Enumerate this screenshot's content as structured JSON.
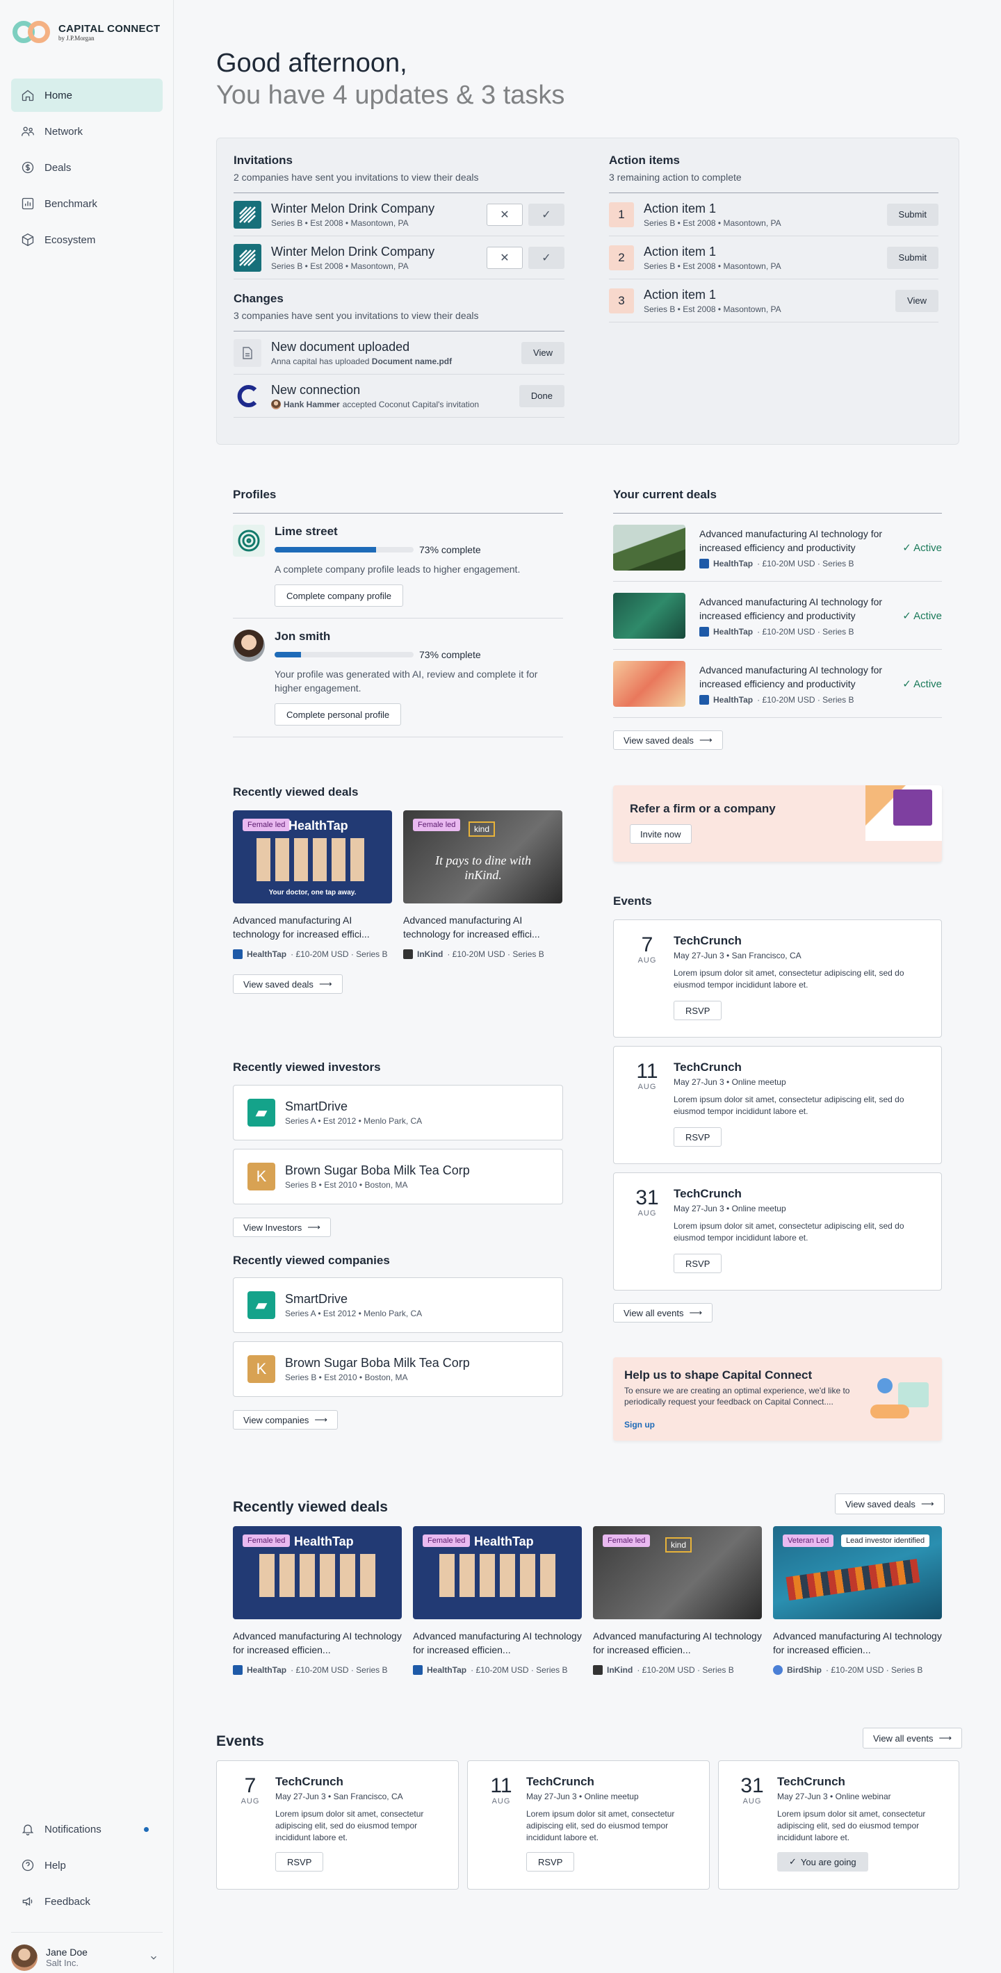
{
  "brand": {
    "title": "CAPITAL CONNECT",
    "sub": "by J.P.Morgan"
  },
  "nav": {
    "items": [
      {
        "label": "Home",
        "icon": "home-icon"
      },
      {
        "label": "Network",
        "icon": "network-icon"
      },
      {
        "label": "Deals",
        "icon": "dollar-icon"
      },
      {
        "label": "Benchmark",
        "icon": "chart-icon"
      },
      {
        "label": "Ecosystem",
        "icon": "cube-icon"
      }
    ],
    "bottom": [
      {
        "label": "Notifications",
        "icon": "bell-icon"
      },
      {
        "label": "Help",
        "icon": "help-icon"
      },
      {
        "label": "Feedback",
        "icon": "feedback-icon"
      }
    ]
  },
  "user": {
    "name": "Jane Doe",
    "org": "Salt Inc."
  },
  "greeting": {
    "line1": "Good afternoon,",
    "line2": "You have 4 updates & 3 tasks"
  },
  "invitations": {
    "title": "Invitations",
    "sub": "2 companies have sent you invitations to view their deals",
    "items": [
      {
        "name": "Winter Melon Drink Company",
        "meta": "Series B • Est 2008 • Masontown, PA"
      },
      {
        "name": "Winter Melon Drink Company",
        "meta": "Series B • Est 2008 • Masontown, PA"
      }
    ]
  },
  "changes": {
    "title": "Changes",
    "sub": "3 companies have sent you invitations to view their deals",
    "items": [
      {
        "title": "New document uploaded",
        "pre": "Anna capital has uploaded ",
        "bold": "Document name.pdf",
        "post": "",
        "button": "View"
      },
      {
        "title": "New connection",
        "pre": "",
        "bold": "Hank Hammer",
        "post": " accepted Coconut Capital's invitation",
        "button": "Done"
      }
    ]
  },
  "actions": {
    "title": "Action items",
    "sub": "3 remaining action to complete",
    "items": [
      {
        "num": "1",
        "title": "Action item 1",
        "meta": "Series B • Est 2008 • Masontown, PA",
        "button": "Submit"
      },
      {
        "num": "2",
        "title": "Action item 1",
        "meta": "Series B • Est 2008 • Masontown, PA",
        "button": "Submit"
      },
      {
        "num": "3",
        "title": "Action item 1",
        "meta": "Series B • Est 2008 • Masontown, PA",
        "button": "View"
      }
    ]
  },
  "profiles": {
    "title": "Profiles",
    "items": [
      {
        "name": "Lime street",
        "progress": 0.73,
        "progress_label": "73% complete",
        "desc": "A complete company profile leads to higher engagement.",
        "button": "Complete company profile"
      },
      {
        "name": "Jon smith",
        "progress": 0.19,
        "progress_label": "73% complete",
        "desc": "Your profile was generated with AI, review and complete it for higher engagement.",
        "button": "Complete personal profile"
      }
    ]
  },
  "current_deals": {
    "title": "Your current deals",
    "items": [
      {
        "desc": "Advanced manufacturing AI technology for increased efficiency and productivity",
        "company": "HealthTap",
        "meta": "· £10-20M USD · Series B",
        "status": "Active"
      },
      {
        "desc": "Advanced manufacturing AI technology for increased efficiency and productivity",
        "company": "HealthTap",
        "meta": "· £10-20M USD · Series B",
        "status": "Active"
      },
      {
        "desc": "Advanced manufacturing AI technology for increased efficiency and productivity",
        "company": "HealthTap",
        "meta": "· £10-20M USD · Series B",
        "status": "Active"
      }
    ],
    "button": "View saved deals"
  },
  "refer": {
    "title": "Refer a firm or a company",
    "button": "Invite now"
  },
  "rv_deals": {
    "title": "Recently viewed deals",
    "items": [
      {
        "tag": "Female led",
        "brand": "HealthTap",
        "tagline": "Your doctor, one tap away.",
        "desc": "Advanced manufacturing AI technology for increased effici...",
        "company": "HealthTap",
        "meta": "· £10-20M USD · Series B"
      },
      {
        "tag": "Female led",
        "brand": "kind",
        "tagline": "It pays to dine with inKind.",
        "desc": "Advanced manufacturing AI technology for increased effici...",
        "company": "InKind",
        "meta": "· £10-20M USD · Series B"
      }
    ],
    "button": "View saved deals"
  },
  "events_side": {
    "title": "Events",
    "items": [
      {
        "day": "7",
        "month": "AUG",
        "title": "TechCrunch",
        "meta": "May 27-Jun 3  •  San Francisco, CA",
        "desc": "Lorem ipsum dolor sit amet, consectetur adipiscing elit, sed do eiusmod tempor incididunt labore et.",
        "button": "RSVP"
      },
      {
        "day": "11",
        "month": "AUG",
        "title": "TechCrunch",
        "meta": "May 27-Jun 3  •  Online meetup",
        "desc": "Lorem ipsum dolor sit amet, consectetur adipiscing elit, sed do eiusmod tempor incididunt labore et.",
        "button": "RSVP"
      },
      {
        "day": "31",
        "month": "AUG",
        "title": "TechCrunch",
        "meta": "May 27-Jun 3  •  Online meetup",
        "desc": "Lorem ipsum dolor sit amet, consectetur adipiscing elit, sed do eiusmod tempor incididunt labore et.",
        "button": "RSVP"
      }
    ],
    "button": "View all events"
  },
  "rv_investors": {
    "title": "Recently viewed investors",
    "items": [
      {
        "name": "SmartDrive",
        "meta": "Series A • Est 2012 • Menlo Park, CA"
      },
      {
        "name": "Brown Sugar Boba Milk Tea Corp",
        "meta": "Series B • Est 2010 • Boston, MA"
      }
    ],
    "button": "View Investors"
  },
  "rv_companies": {
    "title": "Recently viewed companies",
    "items": [
      {
        "name": "SmartDrive",
        "meta": "Series A • Est 2012 • Menlo Park, CA"
      },
      {
        "name": "Brown Sugar Boba Milk Tea Corp",
        "meta": "Series B • Est 2010 • Boston, MA"
      }
    ],
    "button": "View companies"
  },
  "feedback": {
    "title": "Help us to shape Capital Connect",
    "desc": "To ensure we are creating an optimal experience, we'd like to periodically request your feedback on Capital Connect....",
    "link": "Sign up"
  },
  "rv_deals_wide": {
    "title": "Recently viewed deals",
    "button": "View saved deals",
    "items": [
      {
        "tag": "Female led",
        "tag2": "",
        "brand": "HealthTap",
        "desc": "Advanced manufacturing AI technology for increased efficien...",
        "company": "HealthTap",
        "meta": "· £10-20M USD · Series B"
      },
      {
        "tag": "Female led",
        "tag2": "",
        "brand": "HealthTap",
        "desc": "Advanced manufacturing AI technology for increased efficien...",
        "company": "HealthTap",
        "meta": "· £10-20M USD · Series B"
      },
      {
        "tag": "Female led",
        "tag2": "",
        "brand": "kind",
        "desc": "Advanced manufacturing AI technology for increased efficien...",
        "company": "InKind",
        "meta": "· £10-20M USD · Series B"
      },
      {
        "tag": "Veteran Led",
        "tag2": "Lead investor identified",
        "brand": "ship",
        "desc": "Advanced manufacturing AI technology for increased efficien...",
        "company": "BirdShip",
        "meta": "· £10-20M USD · Series B"
      }
    ]
  },
  "events_bottom": {
    "title": "Events",
    "button": "View all events",
    "items": [
      {
        "day": "7",
        "month": "AUG",
        "title": "TechCrunch",
        "meta": "May 27-Jun 3  •  San Francisco, CA",
        "desc": "Lorem ipsum dolor sit amet, consectetur adipiscing elit, sed do eiusmod tempor incididunt labore et.",
        "button": "RSVP"
      },
      {
        "day": "11",
        "month": "AUG",
        "title": "TechCrunch",
        "meta": "May 27-Jun 3  •  Online meetup",
        "desc": "Lorem ipsum dolor sit amet, consectetur adipiscing elit, sed do eiusmod tempor incididunt labore et.",
        "button": "RSVP"
      },
      {
        "day": "31",
        "month": "AUG",
        "title": "TechCrunch",
        "meta": "May 27-Jun 3  •  Online webinar",
        "desc": "Lorem ipsum dolor sit amet, consectetur adipiscing elit, sed do eiusmod tempor incididunt labore et.",
        "button": "You are going"
      }
    ]
  }
}
